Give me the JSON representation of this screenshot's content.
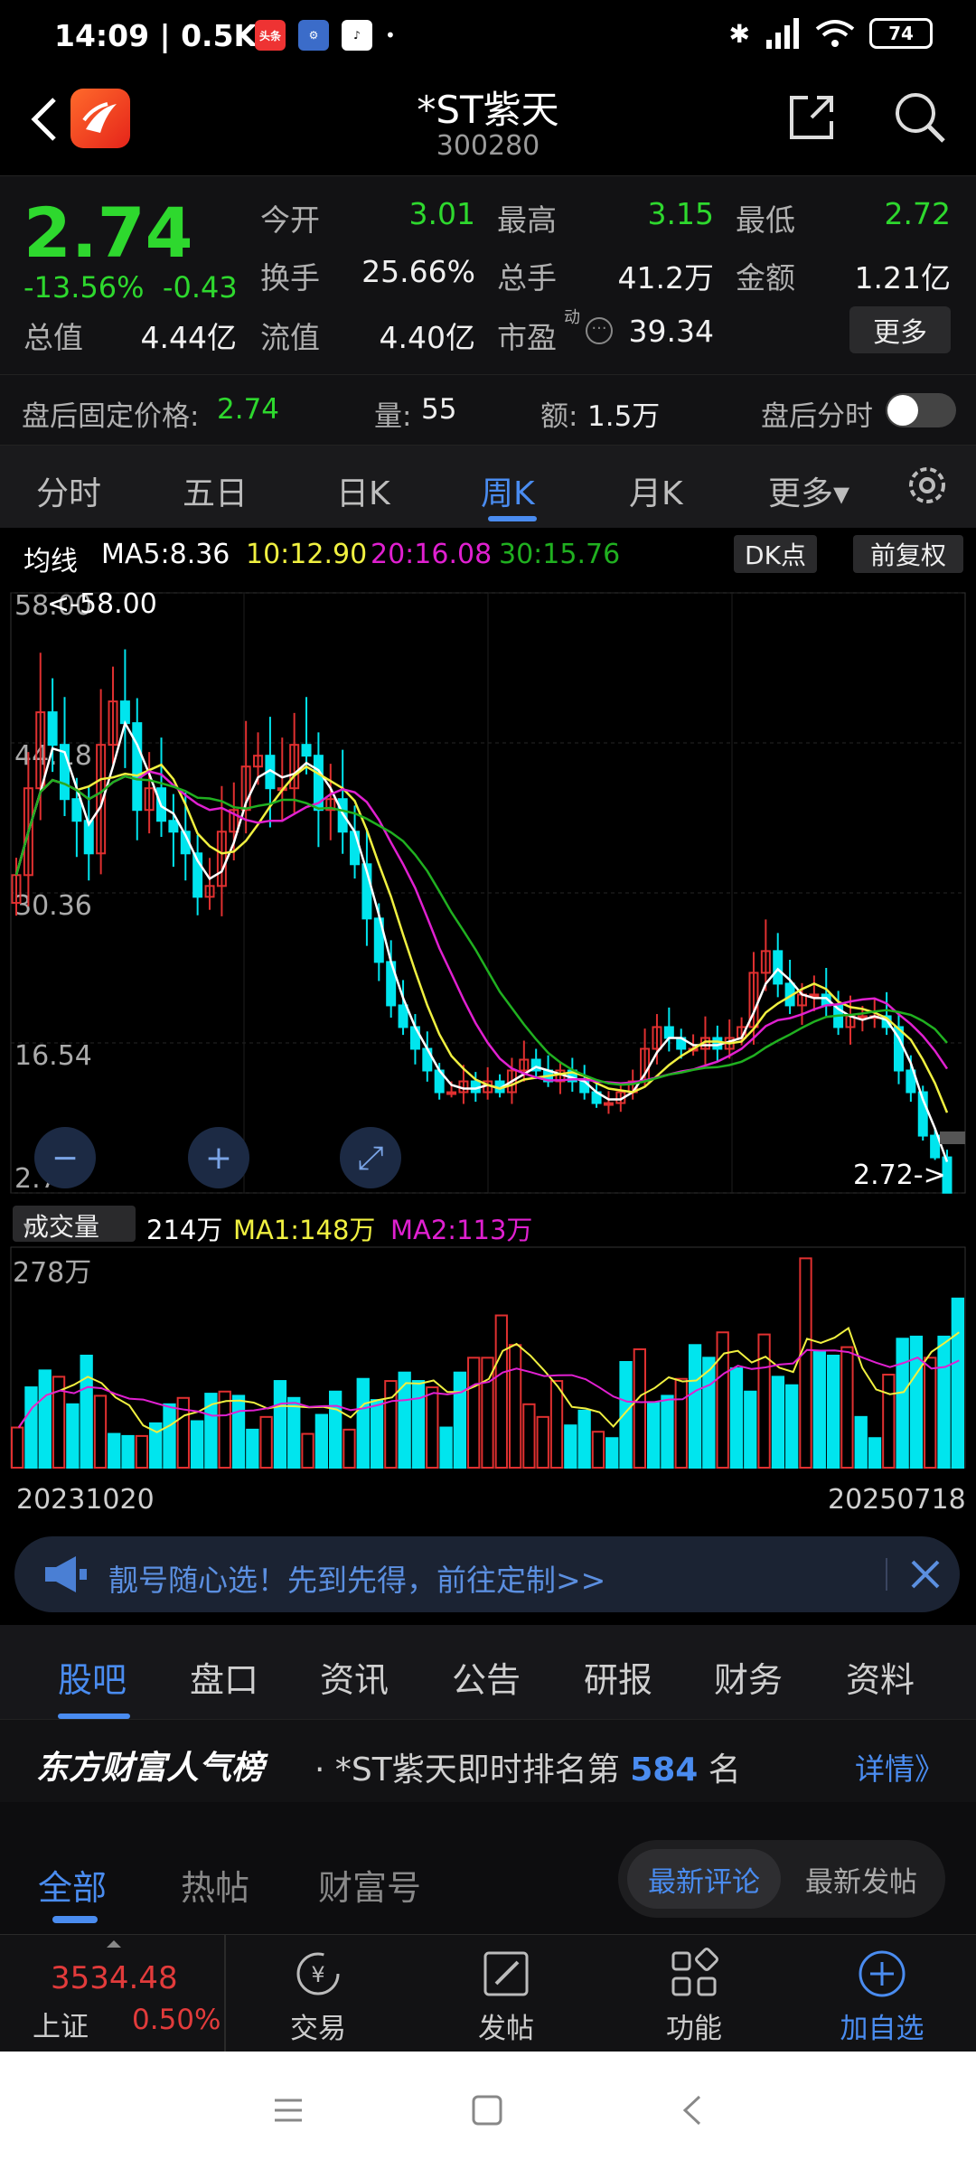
{
  "status_bar": {
    "time": "14:09",
    "speed": "0.5K/s",
    "battery": "74",
    "app1_label": "头条"
  },
  "header": {
    "title": "*ST紫天",
    "code": "300280"
  },
  "quote": {
    "price": "2.74",
    "change_pct": "-13.56%",
    "change_abs": "-0.43",
    "fields": {
      "open_label": "今开",
      "open": "3.01",
      "high_label": "最高",
      "high": "3.15",
      "low_label": "最低",
      "low": "2.72",
      "turnover_label": "换手",
      "turnover": "25.66%",
      "volume_label": "总手",
      "volume": "41.2万",
      "amount_label": "金额",
      "amount": "1.21亿",
      "total_cap_label": "总值",
      "total_cap": "4.44亿",
      "float_cap_label": "流值",
      "float_cap": "4.40亿",
      "pe_label": "市盈",
      "pe_sup": "动",
      "pe": "39.34"
    },
    "more_label": "更多"
  },
  "after_hours": {
    "price_label": "盘后固定价格:",
    "price": "2.74",
    "vol_label": "量:",
    "vol": "55",
    "amt_label": "额:",
    "amt": "1.5万",
    "timeshare_label": "盘后分时"
  },
  "period_tabs": [
    "分时",
    "五日",
    "日K",
    "周K",
    "月K",
    "更多▾"
  ],
  "ma_row": {
    "label": "均线",
    "ma5": "MA5:8.36",
    "ma10": "10:12.90",
    "ma20": "20:16.08",
    "ma30": "30:15.76",
    "dk_label": "DK点",
    "adjust_label": "前复权"
  },
  "chart_data": {
    "type": "candlestick",
    "period": "weekly",
    "y_ticks": [
      "58.00",
      "44.18",
      "30.36",
      "16.54",
      "2.72"
    ],
    "ylim": [
      2.72,
      58.0
    ],
    "max_marker": "<-58.00",
    "min_marker": "2.72->",
    "x_start": "20231020",
    "x_end": "20250718",
    "colors": {
      "up": "#e03030",
      "down": "#00e5ee",
      "ma5": "#ffffff",
      "ma10": "#f0f040",
      "ma20": "#e020d0",
      "ma30": "#20b020"
    },
    "closes": [
      32,
      40,
      47,
      44,
      39,
      37,
      34,
      44,
      48,
      46,
      38,
      40,
      37,
      36,
      34,
      30,
      31,
      36,
      38,
      42,
      43,
      40,
      40,
      44,
      43,
      38,
      39,
      36,
      33,
      28,
      24,
      20,
      18,
      16,
      14,
      12,
      12,
      13,
      12,
      13,
      12,
      14,
      15,
      14,
      13,
      14,
      13,
      12,
      11,
      11,
      12,
      13,
      16,
      18,
      17,
      16,
      16,
      17,
      16,
      17,
      18,
      23,
      25,
      22,
      20,
      21,
      21,
      20,
      18,
      19,
      19,
      19,
      18,
      14,
      12,
      8,
      6,
      2.74
    ]
  },
  "volume": {
    "select_label": "成交量",
    "value": "214万",
    "ma1": "MA1:148万",
    "ma2": "MA2:113万",
    "y_tick": "278万",
    "bars": [
      0.19,
      0.38,
      0.46,
      0.43,
      0.3,
      0.53,
      0.34,
      0.16,
      0.15,
      0.15,
      0.21,
      0.3,
      0.33,
      0.22,
      0.35,
      0.36,
      0.34,
      0.18,
      0.24,
      0.41,
      0.33,
      0.16,
      0.25,
      0.36,
      0.18,
      0.42,
      0.32,
      0.41,
      0.45,
      0.41,
      0.38,
      0.19,
      0.45,
      0.52,
      0.52,
      0.72,
      0.58,
      0.3,
      0.24,
      0.41,
      0.2,
      0.27,
      0.17,
      0.14,
      0.5,
      0.56,
      0.31,
      0.34,
      0.42,
      0.58,
      0.52,
      0.64,
      0.47,
      0.36,
      0.63,
      0.43,
      0.39,
      0.99,
      0.55,
      0.53,
      0.57,
      0.24,
      0.14,
      0.44,
      0.61,
      0.62,
      0.52,
      0.62,
      0.8
    ]
  },
  "banner": {
    "text": "靓号随心选！先到先得，前往定制>>"
  },
  "content_tabs": [
    "股吧",
    "盘口",
    "资讯",
    "公告",
    "研报",
    "财务",
    "资料"
  ],
  "popularity": {
    "brand": "东方财富人气榜",
    "text_prefix": "· *ST紫天即时排名第",
    "rank": "584",
    "text_suffix": "名",
    "detail": "详情》"
  },
  "sub_tabs": [
    "全部",
    "热帖",
    "财富号"
  ],
  "sort_options": [
    "最新评论",
    "最新发帖"
  ],
  "bottom_bar": {
    "index_value": "3534.48",
    "index_name": "上证",
    "index_pct": "0.50%",
    "items": [
      "交易",
      "发帖",
      "功能",
      "加自选"
    ]
  }
}
